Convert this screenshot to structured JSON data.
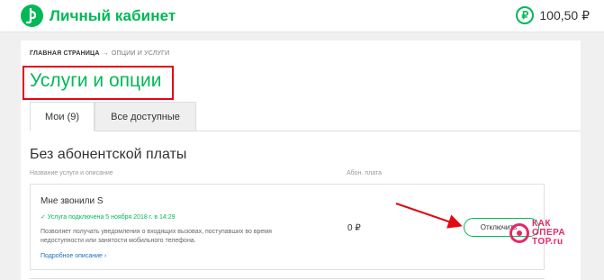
{
  "header": {
    "logo_icon": "operator-logo-icon",
    "title": "Личный кабинет",
    "currency_icon": "ruble-icon",
    "currency_glyph": "₽",
    "balance": "100,50 ₽"
  },
  "breadcrumb": {
    "home": "ГЛАВНАЯ СТРАНИЦА",
    "separator": "→",
    "current": "ОПЦИИ И УСЛУГИ"
  },
  "page": {
    "title": "Услуги и опции"
  },
  "tabs": [
    {
      "label": "Мои (9)",
      "active": true
    },
    {
      "label": "Все доступные",
      "active": false
    }
  ],
  "section": {
    "title": "Без абонентской платы",
    "col_name": "Название услуги и описание",
    "col_fee": "Абон. плата"
  },
  "service": {
    "name": "Мне звонили S",
    "status": "✓ Услуга подключена 5 ноября 2018 г. в 14:29",
    "desc_line1": "Позволяет получать уведомления о входящих вызовах, поступавших во время",
    "desc_line2": "недоступности или занятости мобильного телефона.",
    "more": "Подробное описание ›",
    "price": "0 ₽",
    "disable_label": "Отключить"
  },
  "watermark": {
    "line1": "КАК",
    "line2": "ОПЕРА",
    "line3": "ТОР.ru"
  },
  "colors": {
    "brand": "#00b956",
    "highlight": "#e30613",
    "watermark": "#e5286b"
  }
}
